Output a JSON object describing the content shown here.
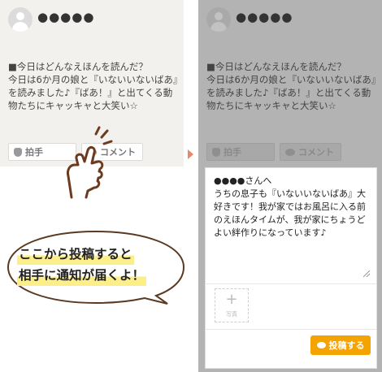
{
  "post": {
    "username": "●●●●●",
    "text": "■今日はどんなえほんを読んだ？\n今日は6か月の娘と『いないいないばあ』を読みました♪『ばあ！』と出てくる動物たちにキャッキャと大笑い☆",
    "like_label": "拍手",
    "comment_label": "コメント"
  },
  "comment_form": {
    "text": "●●●●さんへ\nうちの息子も『いないいないばあ』大好きです！我が家ではお風呂に入る前のえほんタイムが、我が家にちょうどよい絆作りになっています♪",
    "photo_label": "写真",
    "submit_label": "投稿する"
  },
  "callout": {
    "line1": "ここから投稿すると",
    "line2": "相手に通知が届くよ！"
  },
  "colors": {
    "accent_orange": "#f5a300",
    "highlight_yellow": "#fcef8a",
    "arrow_salmon": "#e8876a",
    "hand_brown": "#6b3a1f"
  }
}
